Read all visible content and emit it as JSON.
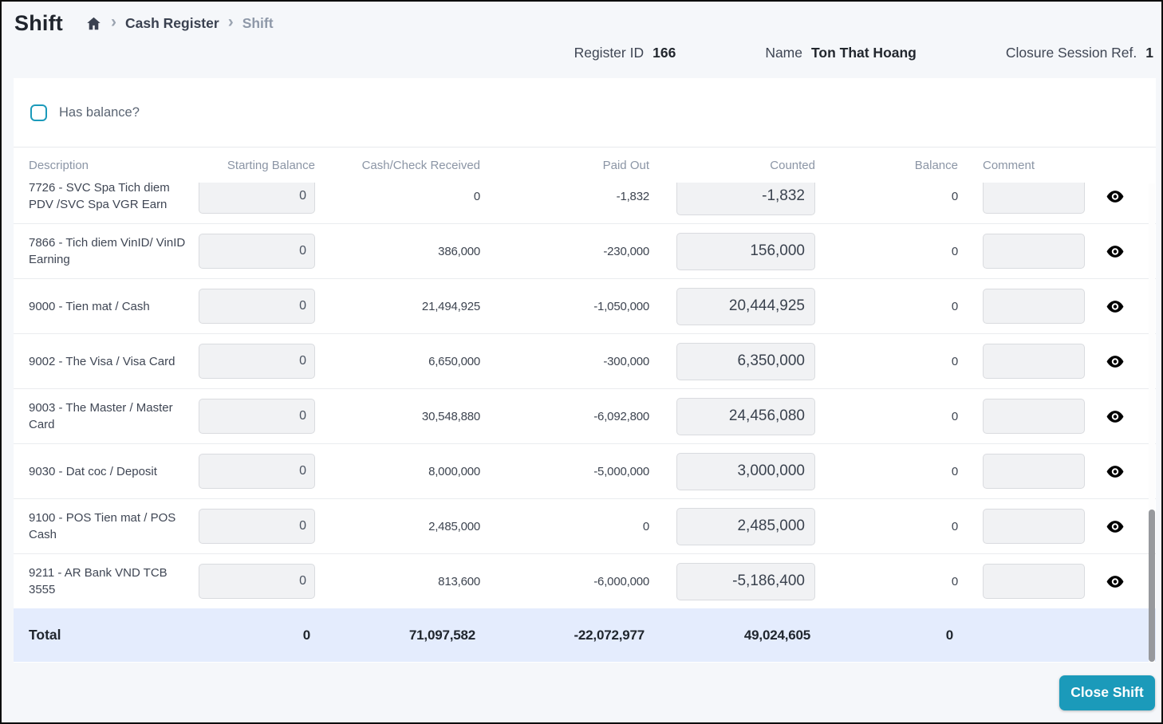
{
  "page": {
    "title": "Shift",
    "breadcrumb": {
      "items": [
        "Cash Register",
        "Shift"
      ]
    }
  },
  "info": {
    "register_id_label": "Register ID",
    "register_id_value": "166",
    "name_label": "Name",
    "name_value": "Ton That Hoang",
    "closure_label": "Closure Session Ref.",
    "closure_value": "1"
  },
  "filters": {
    "has_balance_label": "Has balance?"
  },
  "table": {
    "columns": [
      "Description",
      "Starting Balance",
      "Cash/Check Received",
      "Paid Out",
      "Counted",
      "Balance",
      "Comment"
    ],
    "rows": [
      {
        "description": "7726 - SVC Spa Tich diem PDV /SVC Spa VGR Earn",
        "starting_balance": "0",
        "received": "0",
        "paid_out": "-1,832",
        "counted": "-1,832",
        "balance": "0",
        "comment": ""
      },
      {
        "description": "7866 - Tich diem VinID/ VinID Earning",
        "starting_balance": "0",
        "received": "386,000",
        "paid_out": "-230,000",
        "counted": "156,000",
        "balance": "0",
        "comment": ""
      },
      {
        "description": "9000 - Tien mat / Cash",
        "starting_balance": "0",
        "received": "21,494,925",
        "paid_out": "-1,050,000",
        "counted": "20,444,925",
        "balance": "0",
        "comment": ""
      },
      {
        "description": "9002 - The Visa / Visa Card",
        "starting_balance": "0",
        "received": "6,650,000",
        "paid_out": "-300,000",
        "counted": "6,350,000",
        "balance": "0",
        "comment": ""
      },
      {
        "description": "9003 - The Master / Master Card",
        "starting_balance": "0",
        "received": "30,548,880",
        "paid_out": "-6,092,800",
        "counted": "24,456,080",
        "balance": "0",
        "comment": ""
      },
      {
        "description": "9030 - Dat coc / Deposit",
        "starting_balance": "0",
        "received": "8,000,000",
        "paid_out": "-5,000,000",
        "counted": "3,000,000",
        "balance": "0",
        "comment": ""
      },
      {
        "description": "9100 - POS Tien mat / POS Cash",
        "starting_balance": "0",
        "received": "2,485,000",
        "paid_out": "0",
        "counted": "2,485,000",
        "balance": "0",
        "comment": ""
      },
      {
        "description": "9211 - AR Bank VND TCB 3555",
        "starting_balance": "0",
        "received": "813,600",
        "paid_out": "-6,000,000",
        "counted": "-5,186,400",
        "balance": "0",
        "comment": ""
      }
    ],
    "total": {
      "label": "Total",
      "starting_balance": "0",
      "received": "71,097,582",
      "paid_out": "-22,072,977",
      "counted": "49,024,605",
      "balance": "0"
    }
  },
  "footer": {
    "close_shift_label": "Close Shift"
  },
  "colors": {
    "accent": "#1b9aba",
    "total_row_bg": "#e4ecfd"
  }
}
